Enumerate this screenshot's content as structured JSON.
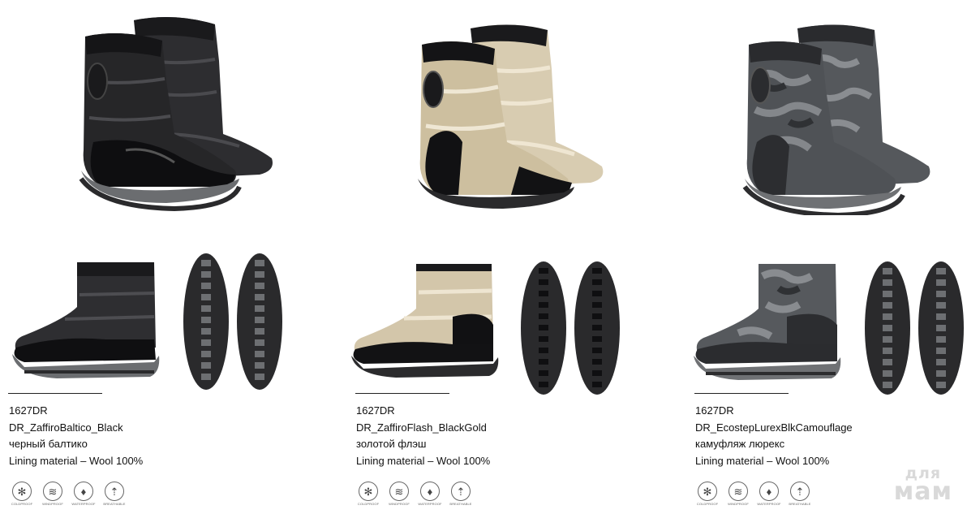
{
  "products": [
    {
      "code": "1627DR",
      "model": "DR_ZaffiroBaltico_Black",
      "color_ru": "черный балтико",
      "lining": "Lining material – Wool 100%",
      "palette": {
        "upper": "#2b2b2d",
        "upper_hi": "#5a5a5e",
        "toe": "#121214",
        "cuff": "#1c1c1e",
        "sole": "#6b6d70",
        "sole_dark": "#2a2a2c"
      }
    },
    {
      "code": "1627DR",
      "model": "DR_ZaffiroFlash_BlackGold",
      "color_ru": "золотой флэш",
      "lining": "Lining material – Wool 100%",
      "palette": {
        "upper": "#cfc2a6",
        "upper_hi": "#efe6d2",
        "toe": "#141416",
        "cuff": "#1a1a1c",
        "sole": "#2a2a2c",
        "sole_dark": "#1a1a1c"
      }
    },
    {
      "code": "1627DR",
      "model": "DR_EcostepLurexBlkCamouflage",
      "color_ru": "камуфляж люрекс",
      "lining": "Lining material – Wool 100%",
      "palette": {
        "upper": "#55585c",
        "upper_hi": "#8a8d91",
        "toe": "#2c2d30",
        "cuff": "#2a2b2e",
        "sole": "#6f7174",
        "sole_dark": "#2c2c2e"
      }
    }
  ],
  "features": [
    {
      "label": "COLDPROOF",
      "icon": "snowflake-icon",
      "glyph": "✻"
    },
    {
      "label": "WINDPROOF",
      "icon": "wind-icon",
      "glyph": "≋"
    },
    {
      "label": "WATERPROOF",
      "icon": "water-drop-icon",
      "glyph": "♦"
    },
    {
      "label": "BREATHABLE",
      "icon": "breathable-icon",
      "glyph": "⇡"
    }
  ],
  "watermark": {
    "line1": "для",
    "line2": "мам"
  }
}
